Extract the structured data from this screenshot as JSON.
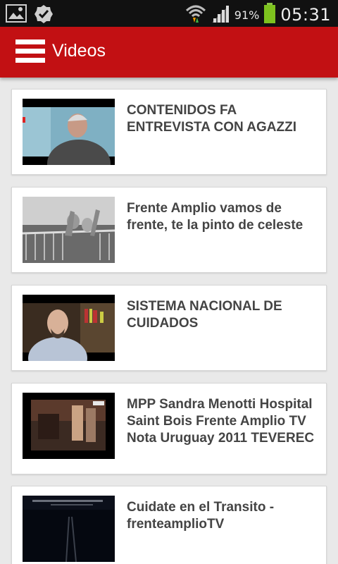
{
  "status_bar": {
    "battery_percent": "91%",
    "time": "05:31",
    "icons": [
      "image-icon",
      "check-badge-icon",
      "wifi-icon",
      "signal-icon",
      "battery-icon"
    ]
  },
  "app_bar": {
    "title": "Videos",
    "color": "#c21013"
  },
  "videos": [
    {
      "title": "CONTENIDOS FA ENTREVISTA CON AGAZZI"
    },
    {
      "title": "Frente Amplio vamos de frente, te la pinto de celeste"
    },
    {
      "title": "SISTEMA NACIONAL DE CUIDADOS"
    },
    {
      "title": "MPP Sandra Menotti Hospital Saint Bois Frente Amplio TV Nota Uruguay 2011 TEVEREC"
    },
    {
      "title": "Cuidate en el Transito - frenteamplioTV"
    }
  ]
}
